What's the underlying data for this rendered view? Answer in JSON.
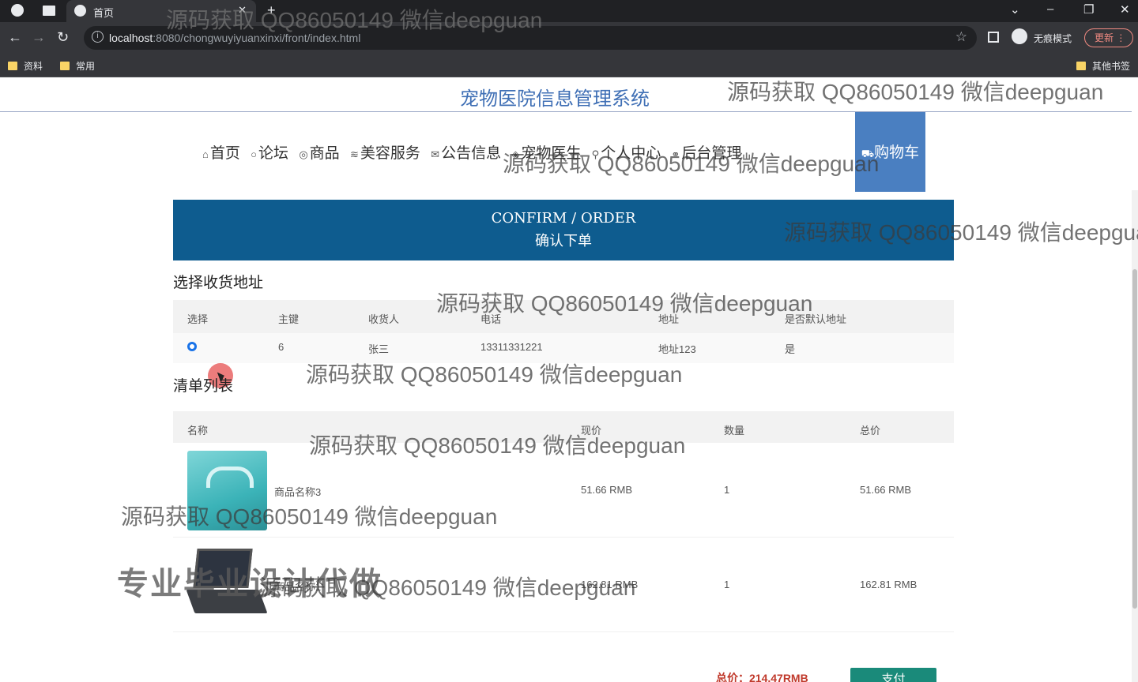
{
  "browser": {
    "tab_title": "首页",
    "new_tab": "+",
    "url_host": "localhost",
    "url_rest": ":8080/chongwuyiyuanxinxi/front/index.html",
    "incognito_label": "无痕模式",
    "update_label": "更新",
    "bookmarks": [
      "资料",
      "常用"
    ],
    "other_bookmarks": "其他书签"
  },
  "site": {
    "title": "宠物医院信息管理系统",
    "nav": [
      {
        "icon": "⌂",
        "label": "首页"
      },
      {
        "icon": "○",
        "label": "论坛"
      },
      {
        "icon": "◎",
        "label": "商品"
      },
      {
        "icon": "≋",
        "label": "美容服务"
      },
      {
        "icon": "✉",
        "label": "公告信息"
      },
      {
        "icon": "◈",
        "label": "宠物医生"
      },
      {
        "icon": "⚲",
        "label": "个人中心"
      },
      {
        "icon": "⚭",
        "label": "后台管理"
      }
    ],
    "cart": {
      "icon": "⛟",
      "label": "购物车"
    }
  },
  "banner": {
    "en": "CONFIRM / ORDER",
    "cn": "确认下单"
  },
  "address": {
    "section_title": "选择收货地址",
    "headers": [
      "选择",
      "主键",
      "收货人",
      "电话",
      "地址",
      "是否默认地址"
    ],
    "rows": [
      {
        "id": "6",
        "name": "张三",
        "phone": "13311331221",
        "address": "地址123",
        "is_default": "是",
        "selected": true
      }
    ]
  },
  "items": {
    "section_title": "清单列表",
    "headers": [
      "名称",
      "现价",
      "数量",
      "总价"
    ],
    "rows": [
      {
        "name": "商品名称3",
        "price": "51.66 RMB",
        "qty": "1",
        "total": "51.66 RMB",
        "image": "teal-box"
      },
      {
        "name": "商品名称1",
        "price": "162.81 RMB",
        "qty": "1",
        "total": "162.81 RMB",
        "image": "laptop"
      }
    ]
  },
  "summary": {
    "total": "总价：214.47RMB",
    "pay_label": "支付"
  },
  "watermark": {
    "text": "源码获取 QQ86050149 微信deepguan",
    "banner_text": "专业毕业设计代做"
  }
}
